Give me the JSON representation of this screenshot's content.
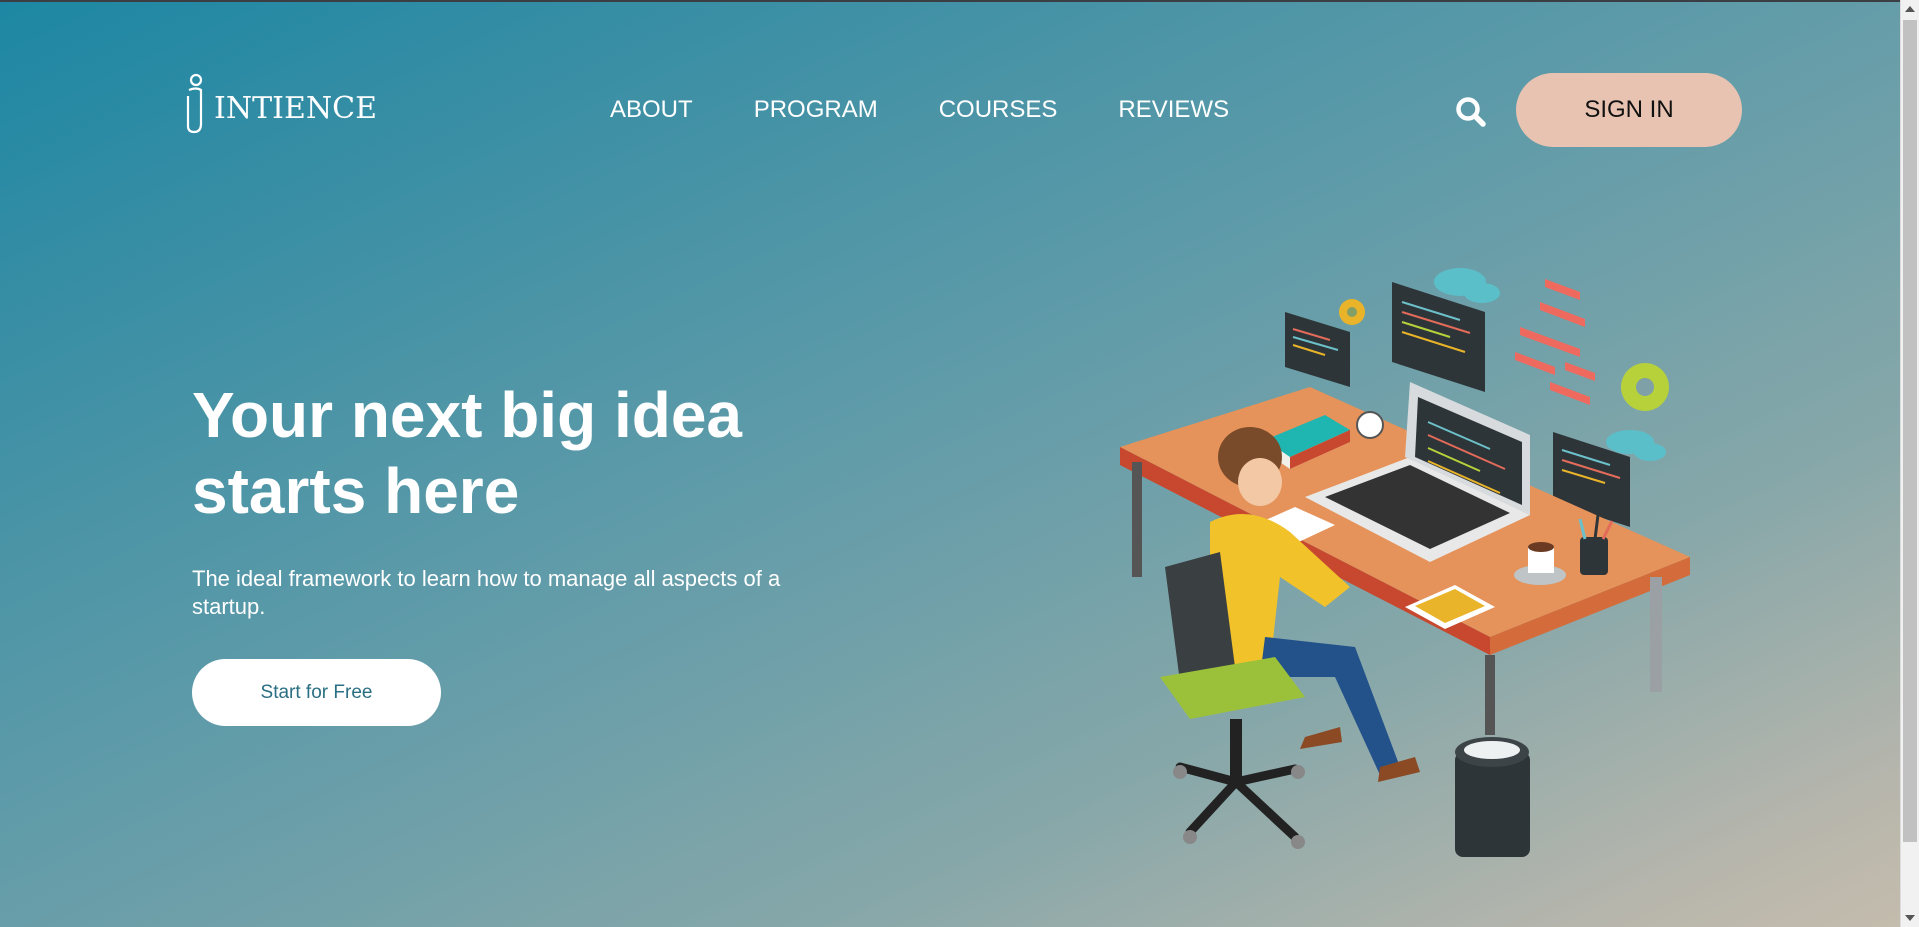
{
  "brand": {
    "name": "INTIENCE",
    "logo_icon": "person-i-logo-icon"
  },
  "nav": {
    "items": [
      {
        "label": "ABOUT"
      },
      {
        "label": "PROGRAM"
      },
      {
        "label": "COURSES"
      },
      {
        "label": "REVIEWS"
      }
    ]
  },
  "header": {
    "search_icon": "search-icon",
    "signin_label": "SIGN IN"
  },
  "hero": {
    "title": "Your next big idea starts here",
    "subtitle": "The ideal framework to learn how to manage all aspects of a startup.",
    "cta_label": "Start for Free",
    "illustration": "developer-at-desk-illustration"
  },
  "colors": {
    "gradient_start": "#1d87a3",
    "gradient_end": "#c4bcad",
    "signin_bg": "#e8c3b1",
    "cta_text": "#2a6f83"
  }
}
